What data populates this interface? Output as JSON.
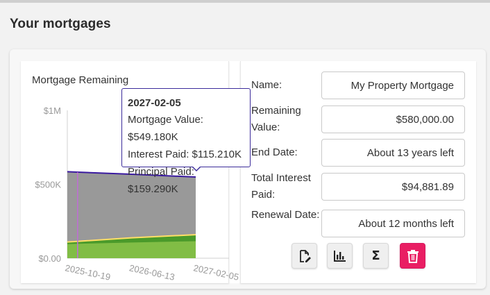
{
  "page": {
    "title": "Your mortgages"
  },
  "chart": {
    "title": "Mortgage Remaining",
    "y_tick_labels": [
      "$1M",
      "$500K",
      "$0.00"
    ],
    "x_tick_labels": [
      "2025-10-19",
      "2026-06-13",
      "2027-02-05"
    ],
    "colors": {
      "mortgage_value": "#999999",
      "mortgage_line": "#3a1aa0",
      "interest_paid": "#8bc34a",
      "interest_line": "#ffe066",
      "principal_paid": "#4a9a2a",
      "hover_line": "#c06cd6",
      "axis": "#d0d0d0"
    },
    "tooltip": {
      "date": "2027-02-05",
      "mortgage_value": "Mortgage Value: $549.180K",
      "interest_paid": "Interest Paid: $115.210K",
      "principal_paid": "Principal Paid: $159.290K"
    }
  },
  "chart_data": {
    "type": "area",
    "title": "Mortgage Remaining",
    "xlabel": "",
    "ylabel": "",
    "x": [
      "2025-10-19",
      "2025-11-26",
      "2026-06-13",
      "2027-02-05"
    ],
    "ylim": [
      0,
      1000000
    ],
    "series": [
      {
        "name": "Mortgage Value",
        "values": [
          585000,
          582000,
          568000,
          549180
        ]
      },
      {
        "name": "Interest Paid",
        "values": [
          94882,
          97500,
          106000,
          115210
        ]
      },
      {
        "name": "Principal Paid",
        "values": [
          110000,
          114000,
          138000,
          159290
        ]
      }
    ],
    "hover_x": "2025-11-26",
    "legend": "none"
  },
  "form": {
    "name": {
      "label": "Name:",
      "value": "My Property Mortgage"
    },
    "remaining_value": {
      "label": "Remaining Value:",
      "value": "$580,000.00"
    },
    "end_date": {
      "label": "End Date:",
      "value": "About 13 years left"
    },
    "total_interest": {
      "label": "Total Interest Paid:",
      "value": "$94,881.89"
    },
    "renewal_date": {
      "label": "Renewal Date:",
      "value": "About 12 months left"
    }
  },
  "actions": {
    "edit_icon": "edit-document-icon",
    "chart_icon": "bar-chart-icon",
    "sum_icon": "sigma-icon",
    "delete_icon": "trash-icon",
    "sum_glyph": "Σ",
    "delete_color": "#e91e63"
  }
}
